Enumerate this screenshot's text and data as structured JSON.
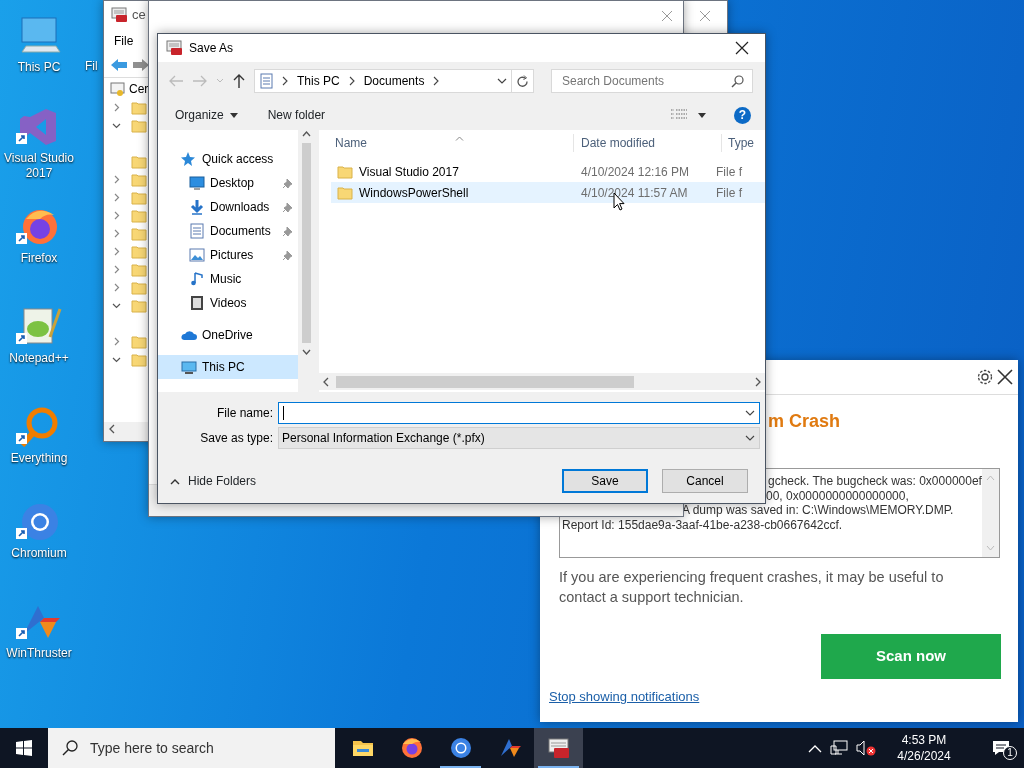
{
  "desktop_icons": [
    {
      "label": "This PC"
    },
    {
      "label": "Visual Studio 2017"
    },
    {
      "label": "Firefox"
    },
    {
      "label": "Notepad++"
    },
    {
      "label": "Everything"
    },
    {
      "label": "Chromium"
    },
    {
      "label": "WinThruster"
    },
    {
      "label": "Fil"
    }
  ],
  "background_window": {
    "title": "ce",
    "menu": [
      "File"
    ],
    "tree_root": "Cer",
    "tree_rows": [
      {
        "kind": "folder",
        "expanded": false
      },
      {
        "kind": "folder",
        "expanded": true
      },
      {
        "kind": "blank"
      },
      {
        "kind": "leaf"
      },
      {
        "kind": "folder",
        "expanded": false
      },
      {
        "kind": "folder",
        "expanded": false
      },
      {
        "kind": "folder",
        "expanded": false
      },
      {
        "kind": "folder",
        "expanded": false
      },
      {
        "kind": "folder",
        "expanded": false
      },
      {
        "kind": "folder",
        "expanded": false
      },
      {
        "kind": "folder",
        "expanded": false
      },
      {
        "kind": "folder",
        "expanded": true
      },
      {
        "kind": "blank"
      },
      {
        "kind": "folder",
        "expanded": false
      },
      {
        "kind": "folder",
        "expanded": true
      }
    ]
  },
  "save_dialog": {
    "title": "Save As",
    "breadcrumb": [
      "This PC",
      "Documents"
    ],
    "search_placeholder": "Search Documents",
    "toolbar": {
      "organize": "Organize",
      "new_folder": "New folder",
      "help": "?"
    },
    "nav_pane": [
      {
        "label": "Quick access",
        "selected": false,
        "children": [
          {
            "label": "Desktop",
            "pinned": true,
            "selected": false
          },
          {
            "label": "Downloads",
            "pinned": true,
            "selected": false
          },
          {
            "label": "Documents",
            "pinned": true,
            "selected": false
          },
          {
            "label": "Pictures",
            "pinned": true,
            "selected": false
          },
          {
            "label": "Music",
            "pinned": false,
            "selected": false
          },
          {
            "label": "Videos",
            "pinned": false,
            "selected": false
          }
        ]
      },
      {
        "label": "OneDrive",
        "selected": false
      },
      {
        "label": "This PC",
        "selected": true
      }
    ],
    "columns": [
      {
        "label": "Name",
        "sorted": true
      },
      {
        "label": "Date modified",
        "sorted": false
      },
      {
        "label": "Type",
        "sorted": false
      }
    ],
    "rows": [
      {
        "name": "Visual Studio 2017",
        "date": "4/10/2024 12:16 PM",
        "type": "File f",
        "hovered": false
      },
      {
        "name": "WindowsPowerShell",
        "date": "4/10/2024 11:57 AM",
        "type": "File f",
        "hovered": true
      }
    ],
    "file_name_label": "File name:",
    "type_label": "Save as type:",
    "type_value": "Personal Information Exchange (*.pfx)",
    "hide_folders": "Hide Folders",
    "save": "Save",
    "cancel": "Cancel"
  },
  "notification": {
    "title": "m Crash",
    "details": [
      "gcheck.  The bugcheck was: 0x000000ef",
      "00, 0x0000000000000000,",
      "A dump was saved in: C:\\Windows\\MEMORY.DMP.",
      "Report Id: 155dae9a-3aaf-41be-a238-cb0667642ccf."
    ],
    "message": "If you are experiencing frequent crashes, it may be useful to contact a support technician.",
    "scan_button": "Scan now",
    "stop_link": "Stop showing notifications"
  },
  "taskbar": {
    "search_placeholder": "Type here to search",
    "apps": [
      {
        "running": false,
        "selected": false
      },
      {
        "running": false,
        "selected": false
      },
      {
        "running": true,
        "selected": false
      },
      {
        "running": false,
        "selected": false
      },
      {
        "running": true,
        "selected": true
      }
    ],
    "time": "4:53 PM",
    "date": "4/26/2024",
    "notification_count": "1"
  }
}
